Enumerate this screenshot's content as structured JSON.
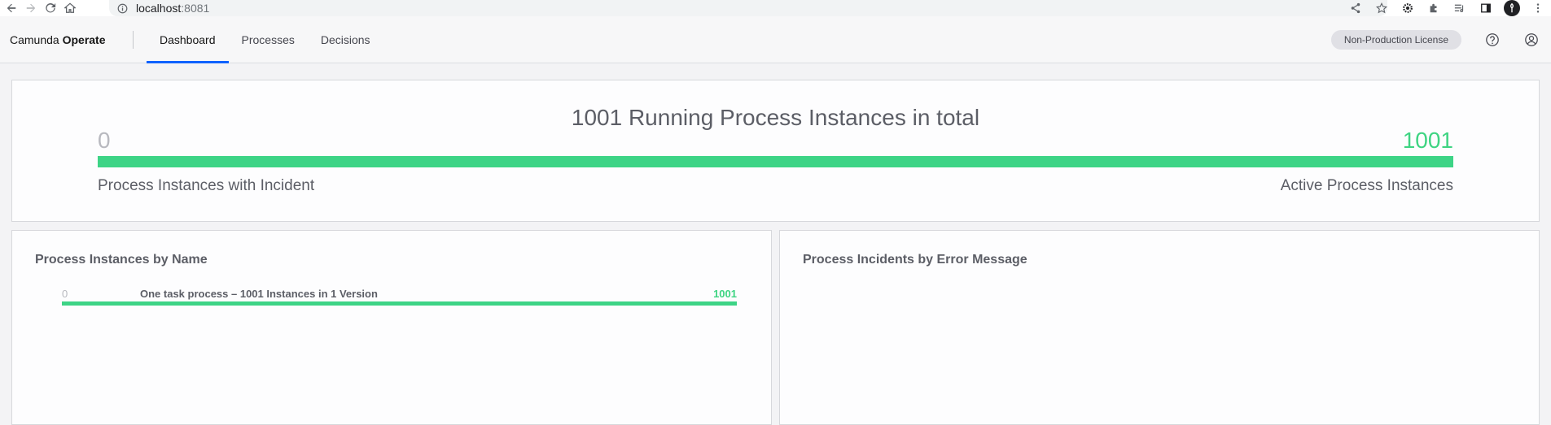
{
  "browser": {
    "url_host": "localhost",
    "url_port": ":8081"
  },
  "header": {
    "brand_prefix": "Camunda",
    "brand_name": "Operate",
    "tabs": [
      {
        "label": "Dashboard",
        "active": true
      },
      {
        "label": "Processes",
        "active": false
      },
      {
        "label": "Decisions",
        "active": false
      }
    ],
    "license_label": "Non-Production License"
  },
  "summary": {
    "title": "1001 Running Process Instances in total",
    "incident_count": "0",
    "active_count": "1001",
    "incident_label": "Process Instances with Incident",
    "active_label": "Active Process Instances",
    "active_fraction": 1.0
  },
  "by_name": {
    "title": "Process Instances by Name",
    "rows": [
      {
        "incident_count": "0",
        "label": "One task process – 1001 Instances in 1 Version",
        "active_count": "1001",
        "active_fraction": 1.0
      }
    ]
  },
  "by_error": {
    "title": "Process Incidents by Error Message"
  },
  "colors": {
    "active": "#3dd486",
    "incident_zero": "#b8b9bf",
    "accent": "#0f62fe"
  }
}
